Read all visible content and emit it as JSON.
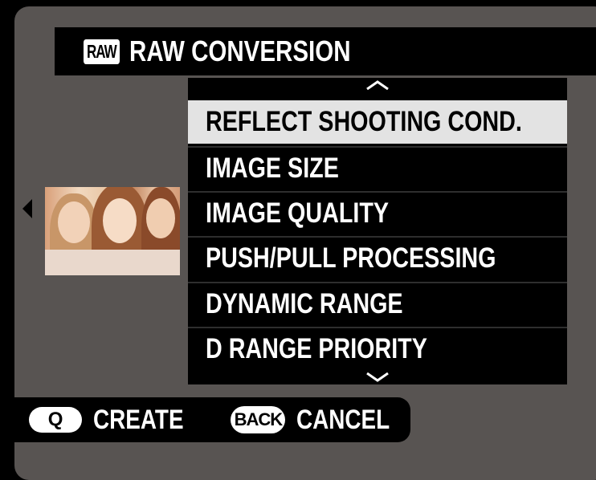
{
  "header": {
    "badge": "RAW",
    "title": "RAW CONVERSION"
  },
  "menu": {
    "items": [
      {
        "label": "REFLECT SHOOTING COND.",
        "selected": true
      },
      {
        "label": "IMAGE SIZE",
        "selected": false
      },
      {
        "label": "IMAGE QUALITY",
        "selected": false
      },
      {
        "label": "PUSH/PULL PROCESSING",
        "selected": false
      },
      {
        "label": "DYNAMIC RANGE",
        "selected": false
      },
      {
        "label": "D RANGE PRIORITY",
        "selected": false
      }
    ],
    "scroll_up_icon": "chevron-up-icon",
    "scroll_down_icon": "chevron-down-icon"
  },
  "footer": {
    "q_key": "Q",
    "q_action": "CREATE",
    "back_key": "BACK",
    "back_action": "CANCEL"
  },
  "colors": {
    "background": "#585452",
    "selected_bg": "#e3e3e3",
    "panel": "#000000"
  }
}
